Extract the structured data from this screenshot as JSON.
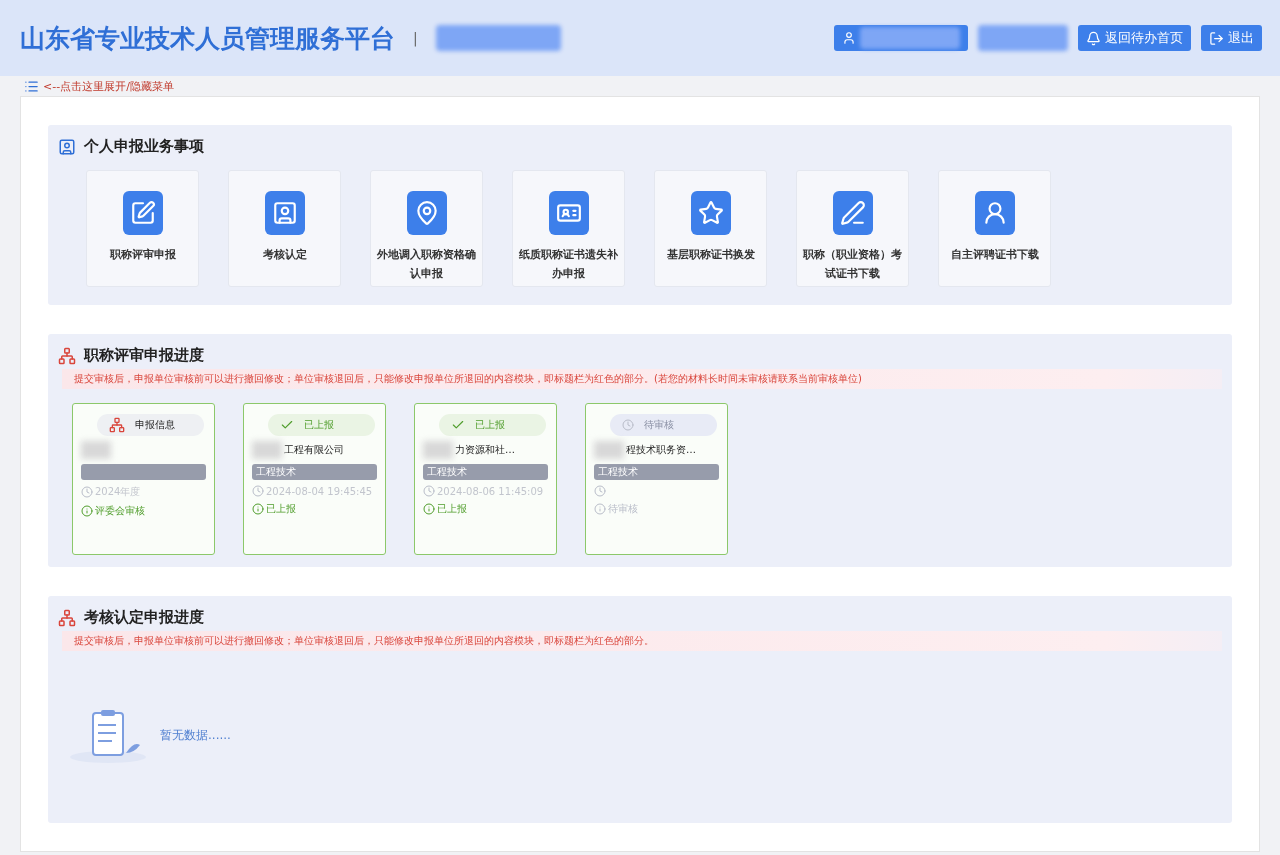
{
  "header": {
    "title": "山东省专业技术人员管理服务平台",
    "separator": "|",
    "buttons": [
      {
        "kind": "home",
        "label": "返回待办首页"
      },
      {
        "kind": "logout",
        "label": "退出"
      }
    ]
  },
  "menu_toggle": {
    "label": "<--点击这里展开/隐藏菜单"
  },
  "business": {
    "title": "个人申报业务事项",
    "tiles": [
      {
        "kind": "edit",
        "label": "职称评审申报"
      },
      {
        "kind": "person",
        "label": "考核认定"
      },
      {
        "kind": "map",
        "label": "外地调入职称资格确认申报"
      },
      {
        "kind": "card",
        "label": "纸质职称证书遗失补办申报"
      },
      {
        "kind": "star",
        "label": "基层职称证书换发"
      },
      {
        "kind": "pen",
        "label": "职称（职业资格）考试证书下载"
      },
      {
        "kind": "user",
        "label": "自主评聘证书下载"
      }
    ]
  },
  "progress": {
    "title": "职称评审申报进度",
    "notice": "提交审核后，申报单位审核前可以进行撤回修改；单位审核退回后，只能修改申报单位所退回的内容模块，即标题栏为红色的部分。(若您的材料长时间未审核请联系当前审核单位)",
    "cards": [
      {
        "header": {
          "kind": "info",
          "label": "申报信息"
        },
        "time": "2024年度",
        "status": {
          "kind": "active",
          "label": "评委会审核"
        }
      },
      {
        "header": {
          "kind": "done",
          "label": "已上报"
        },
        "org": "工程有限公司",
        "category": "工程技术",
        "time": "2024-08-04 19:45:45",
        "status": {
          "kind": "active",
          "label": "已上报"
        }
      },
      {
        "header": {
          "kind": "done",
          "label": "已上报"
        },
        "org": "力资源和社…",
        "category": "工程技术",
        "time": "2024-08-06 11:45:09",
        "status": {
          "kind": "active",
          "label": "已上报"
        }
      },
      {
        "header": {
          "kind": "pending",
          "label": "待审核"
        },
        "org": "程技术职务资…",
        "category": "工程技术",
        "status": {
          "kind": "pending",
          "label": "待审核"
        }
      }
    ]
  },
  "assessment": {
    "title": "考核认定申报进度",
    "notice": "提交审核后，申报单位审核前可以进行撤回修改；单位审核退回后，只能修改申报单位所退回的内容模块，即标题栏为红色的部分。",
    "empty": "暂无数据......"
  }
}
